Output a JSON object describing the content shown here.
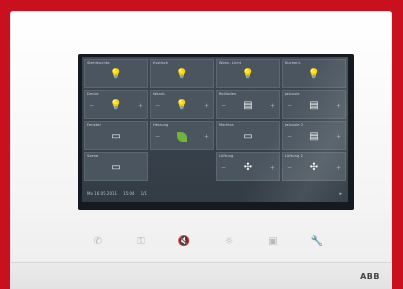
{
  "brand": "ABB",
  "screen": {
    "tiles": [
      {
        "name": "Stehleuchte",
        "kind": "bulb"
      },
      {
        "name": "Esstisch",
        "kind": "bulb"
      },
      {
        "name": "Wohn. Licht",
        "kind": "bulb"
      },
      {
        "name": "Kuchenl.",
        "kind": "bulb"
      },
      {
        "name": "Decke",
        "kind": "bulb-dim"
      },
      {
        "name": "Wandl.",
        "kind": "bulb-dim"
      },
      {
        "name": "Rollladen",
        "kind": "blind"
      },
      {
        "name": "Jalousie",
        "kind": "blind"
      },
      {
        "name": "Fenster",
        "kind": "plain"
      },
      {
        "name": "Heizung",
        "kind": "leaf"
      },
      {
        "name": "Markise",
        "kind": "plain"
      },
      {
        "name": "Jalousie 2",
        "kind": "blind"
      },
      {
        "name": "Szene",
        "kind": "plain"
      },
      {
        "name": "",
        "kind": "empty"
      },
      {
        "name": "Lüftung",
        "kind": "fan"
      },
      {
        "name": "Lüftung 2",
        "kind": "fan"
      }
    ],
    "status_bar": {
      "date": "Mo 16.05.2011",
      "time": "15:04",
      "page": "1/1"
    }
  },
  "hardware_buttons": [
    {
      "icon": "phone-icon"
    },
    {
      "icon": "key-icon"
    },
    {
      "icon": "mute-icon"
    },
    {
      "icon": "light-icon"
    },
    {
      "icon": "screen-icon"
    },
    {
      "icon": "wrench-icon"
    }
  ]
}
